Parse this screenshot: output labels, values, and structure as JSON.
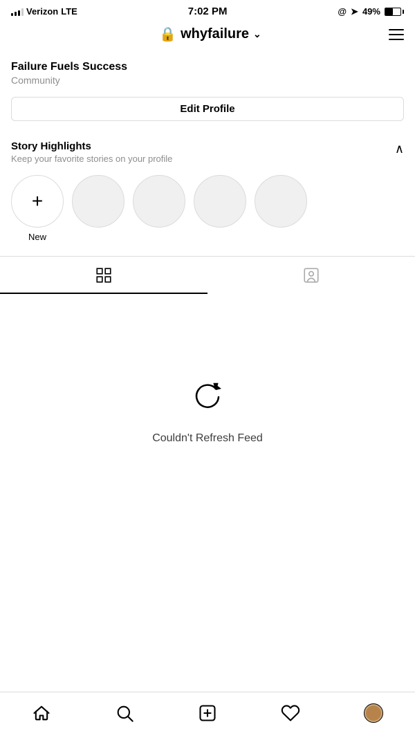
{
  "statusBar": {
    "carrier": "Verizon",
    "network": "LTE",
    "time": "7:02 PM",
    "battery": "49%"
  },
  "header": {
    "lockIcon": "🔒",
    "username": "whyfailure",
    "chevron": "∨",
    "menuIcon": "hamburger-menu"
  },
  "profile": {
    "name": "Failure Fuels Success",
    "subtitle": "Community",
    "editButtonLabel": "Edit Profile"
  },
  "highlights": {
    "title": "Story Highlights",
    "subtitle": "Keep your favorite stories on your profile",
    "chevronUp": "∧",
    "newLabel": "New",
    "circles": [
      {
        "id": "new",
        "label": "New",
        "isNew": true
      },
      {
        "id": "c1",
        "label": "",
        "isNew": false
      },
      {
        "id": "c2",
        "label": "",
        "isNew": false
      },
      {
        "id": "c3",
        "label": "",
        "isNew": false
      },
      {
        "id": "c4",
        "label": "",
        "isNew": false
      }
    ]
  },
  "tabs": [
    {
      "id": "grid",
      "label": "Grid",
      "active": true
    },
    {
      "id": "tagged",
      "label": "Tagged",
      "active": false
    }
  ],
  "errorState": {
    "message": "Couldn't Refresh Feed"
  },
  "bottomNav": {
    "items": [
      {
        "id": "home",
        "label": "Home"
      },
      {
        "id": "search",
        "label": "Search"
      },
      {
        "id": "new-post",
        "label": "New Post"
      },
      {
        "id": "activity",
        "label": "Activity"
      },
      {
        "id": "profile",
        "label": "Profile"
      }
    ]
  }
}
